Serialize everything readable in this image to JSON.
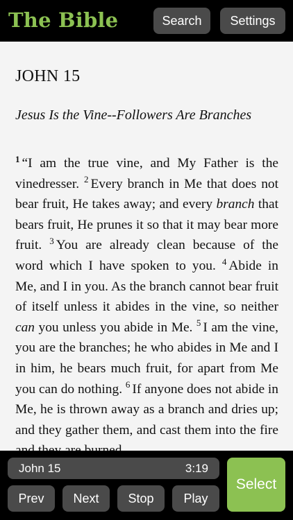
{
  "header": {
    "app_title": "The Bible",
    "search_label": "Search",
    "settings_label": "Settings"
  },
  "reader": {
    "chapter": "JOHN 15",
    "section_heading": "Jesus Is the Vine--Followers Are Branches",
    "verses": [
      {
        "num": "1",
        "parts": [
          {
            "t": "“I am the true vine, and My Father is the vinedresser."
          }
        ]
      },
      {
        "num": "2",
        "parts": [
          {
            "t": "Every branch in Me that does not bear fruit, He takes away; and every "
          },
          {
            "t": "branch",
            "i": true
          },
          {
            "t": " that bears fruit, He prunes it so that it may bear more fruit."
          }
        ]
      },
      {
        "num": "3",
        "parts": [
          {
            "t": "You are already clean because of the word which I have spoken to you."
          }
        ]
      },
      {
        "num": "4",
        "parts": [
          {
            "t": "Abide in Me, and I in you. As the branch cannot bear fruit of itself unless it abides in the vine, so neither "
          },
          {
            "t": "can",
            "i": true
          },
          {
            "t": " you unless you abide in Me."
          }
        ]
      },
      {
        "num": "5",
        "parts": [
          {
            "t": "I am the vine, you are the branches; he who abides in Me and I in him, he bears much fruit, for apart from Me you can do nothing."
          }
        ]
      },
      {
        "num": "6",
        "parts": [
          {
            "t": "If anyone does not abide in Me, he is thrown away as a branch and dries up; and they gather them, and cast them into the fire and they are burned."
          }
        ]
      }
    ]
  },
  "controls": {
    "current_ref": "John 15",
    "time": "3:19",
    "prev_label": "Prev",
    "next_label": "Next",
    "stop_label": "Stop",
    "play_label": "Play",
    "select_label": "Select"
  },
  "colors": {
    "accent": "#8cc152",
    "button_bg": "#4a4a4a",
    "page_bg": "#f4f4f4"
  }
}
